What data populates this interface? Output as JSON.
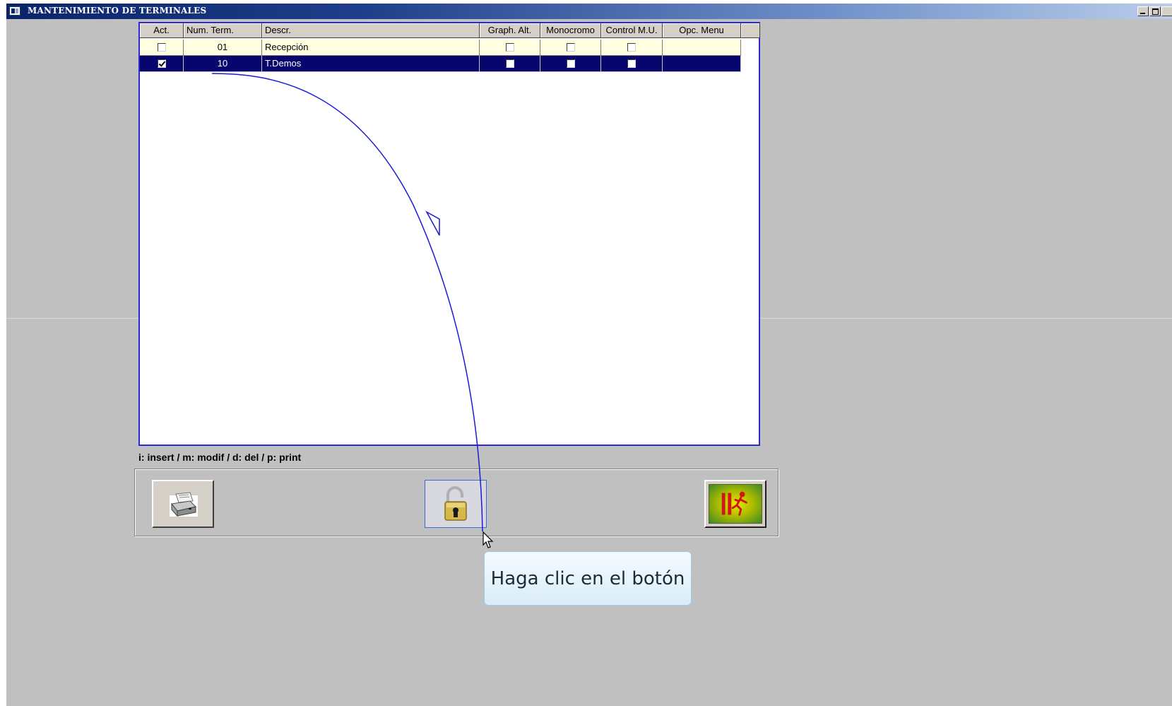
{
  "window": {
    "title": "MANTENIMIENTO DE TERMINALES"
  },
  "grid": {
    "columns": [
      "Act.",
      "Num. Term.",
      "Descr.",
      "Graph. Alt.",
      "Monocromo",
      "Control M.U.",
      "Opc. Menu"
    ],
    "rows": [
      {
        "act": false,
        "num": "01",
        "descr": "Recepción",
        "graph_alt": false,
        "monocromo": false,
        "control_mu": false,
        "opc_menu": "",
        "selected": false
      },
      {
        "act": true,
        "num": "10",
        "descr": "T.Demos",
        "graph_alt": false,
        "monocromo": false,
        "control_mu": false,
        "opc_menu": "",
        "selected": true
      }
    ]
  },
  "hint_text": "i: insert / m: modif / d: del / p: print",
  "buttons": {
    "print": {
      "icon": "printer-icon"
    },
    "lock": {
      "icon": "unlocked-padlock-icon"
    },
    "exit": {
      "icon": "exit-running-man-icon"
    }
  },
  "tooltip": {
    "text": "Haga clic en el botón"
  },
  "colors": {
    "title_bar": "#0a246a",
    "selected_row": "#06066e",
    "normal_row": "#ffffe0",
    "grid_border": "#2a2ad0",
    "annotation_line": "#1a1ad8",
    "background": "#c0c0c0"
  }
}
